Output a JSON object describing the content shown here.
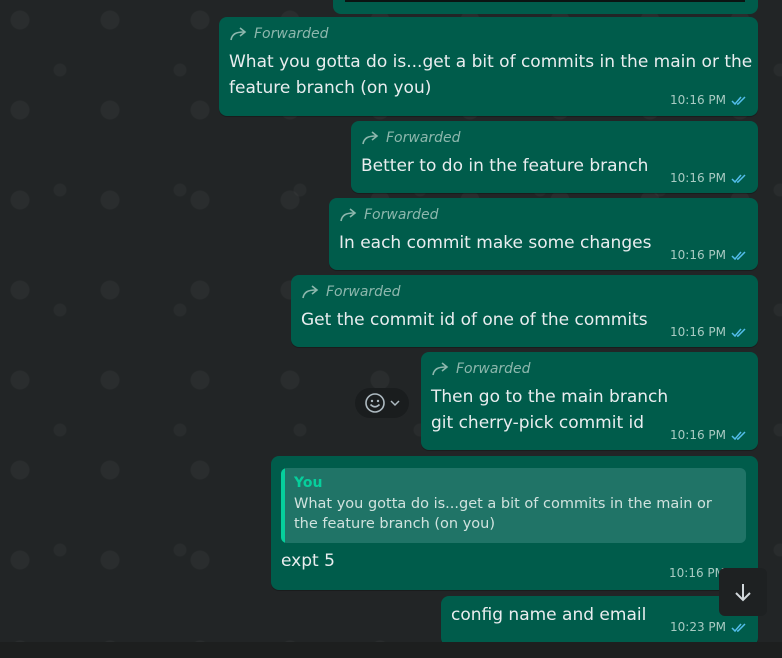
{
  "messages": [
    {
      "forwarded_label": "Forwarded",
      "lines": [
        "What you gotta do is...get a bit of commits in the main or the",
        "feature branch (on you)"
      ],
      "time": "10:16 PM"
    },
    {
      "forwarded_label": "Forwarded",
      "lines": [
        "Better to do in the feature branch"
      ],
      "time": "10:16 PM"
    },
    {
      "forwarded_label": "Forwarded",
      "lines": [
        "In each commit make some changes"
      ],
      "time": "10:16 PM"
    },
    {
      "forwarded_label": "Forwarded",
      "lines": [
        "Get the commit id of one of the commits"
      ],
      "time": "10:16 PM"
    },
    {
      "forwarded_label": "Forwarded",
      "lines": [
        "Then go to the main branch",
        "git cherry-pick commit id"
      ],
      "time": "10:16 PM"
    },
    {
      "quote_author": "You",
      "quote_text": "What you gotta do is...get a bit of commits in the main or the feature branch (on you)",
      "lines": [
        "expt 5"
      ],
      "time": "10:16 PM"
    },
    {
      "lines": [
        "config name and email"
      ],
      "time": "10:23 PM"
    }
  ],
  "icons": {
    "forward": "forward-arrow-icon",
    "read_receipt": "double-check-icon",
    "emoji": "smiley-icon",
    "chevron": "chevron-down-icon",
    "scroll_down": "arrow-down-icon"
  },
  "colors": {
    "outgoing_bubble": "#005c4b",
    "background": "#222526",
    "read_tick": "#53bdeb",
    "quote_accent": "#06cf9c"
  }
}
